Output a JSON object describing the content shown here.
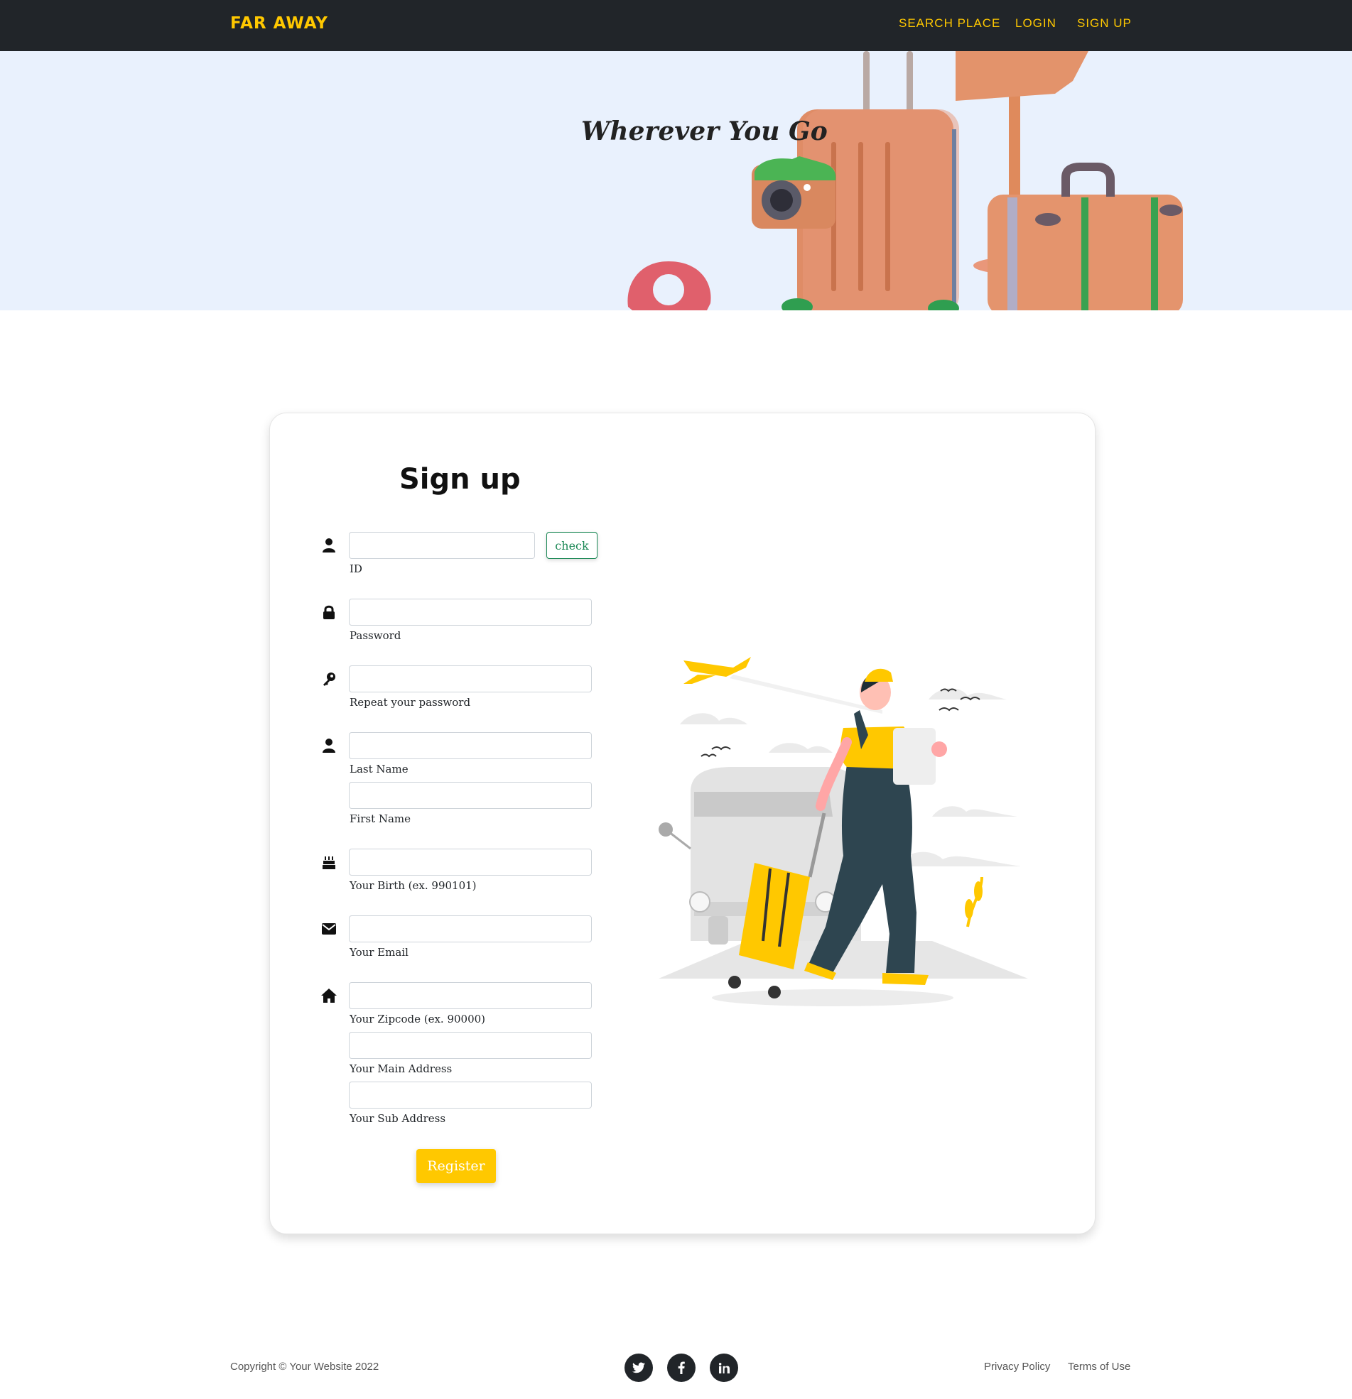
{
  "navbar": {
    "brand": "FAR AWAY",
    "links": [
      "SEARCH PLACE",
      "LOGIN",
      "SIGN UP"
    ],
    "accent_color": "#ffc800",
    "background_color": "#212529"
  },
  "hero": {
    "title": "Wherever You Go",
    "background_color": "#e9f1fd"
  },
  "form": {
    "title": "Sign up",
    "check_button": "check",
    "register_button": "Register",
    "fields": {
      "id": {
        "label": "ID",
        "icon": "user-icon",
        "value": ""
      },
      "password": {
        "label": "Password",
        "icon": "lock-icon",
        "value": ""
      },
      "repeat_password": {
        "label": "Repeat your password",
        "icon": "key-icon",
        "value": ""
      },
      "last_name": {
        "label": "Last Name",
        "icon": "user-icon",
        "value": ""
      },
      "first_name": {
        "label": "First Name",
        "value": ""
      },
      "birth": {
        "label": "Your Birth (ex. 990101)",
        "icon": "birthday-cake-icon",
        "value": ""
      },
      "email": {
        "label": "Your Email",
        "icon": "envelope-icon",
        "value": ""
      },
      "zipcode": {
        "label": "Your Zipcode (ex. 90000)",
        "icon": "home-icon",
        "value": ""
      },
      "main_address": {
        "label": "Your Main Address",
        "value": ""
      },
      "sub_address": {
        "label": "Your Sub Address",
        "value": ""
      }
    }
  },
  "footer": {
    "copyright": "Copyright © Your Website 2022",
    "social": [
      "twitter-icon",
      "facebook-icon",
      "linkedin-icon"
    ],
    "links": [
      "Privacy Policy",
      "Terms of Use"
    ]
  }
}
